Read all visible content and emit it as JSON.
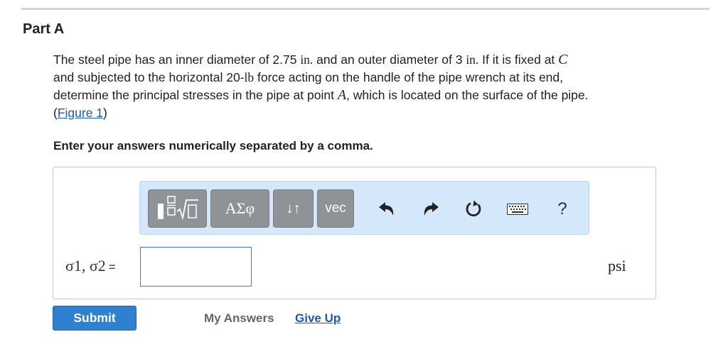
{
  "part_title": "Part A",
  "problem": {
    "t1": "The steel pipe has an inner diameter of 2.75 ",
    "u1": "in.",
    "t2": " and an outer diameter of 3 ",
    "u2": "in.",
    "t3": " If it is fixed at ",
    "v1": "C",
    "t4": "and subjected to the horizontal 20-",
    "u3": "lb",
    "t5": " force acting on the handle of the pipe wrench at its end,",
    "t6": "determine the principal stresses in the pipe at point ",
    "v2": "A",
    "t7": ", which is located on the surface of the pipe.",
    "paren_open": "(",
    "figure_link": "Figure 1",
    "paren_close": ")"
  },
  "instruction": "Enter your answers numerically separated by a comma.",
  "toolbar": {
    "greek_label": "ΑΣφ",
    "arrows_label": "↓↑",
    "vec_label": "vec",
    "help_label": "?",
    "icons": [
      "templates-icon",
      "undo-icon",
      "redo-icon",
      "reset-icon",
      "keyboard-icon",
      "help-icon"
    ]
  },
  "answer": {
    "label": "σ1, σ2",
    "equals": "=",
    "value": "",
    "unit": "psi"
  },
  "actions": {
    "submit": "Submit",
    "my_answers": "My Answers",
    "give_up": "Give Up"
  },
  "colors": {
    "link": "#1a5aa8",
    "submit_bg": "#2f80d1",
    "toolbar_bg": "#d5e7fa",
    "toolbar_button": "#8f9297"
  }
}
